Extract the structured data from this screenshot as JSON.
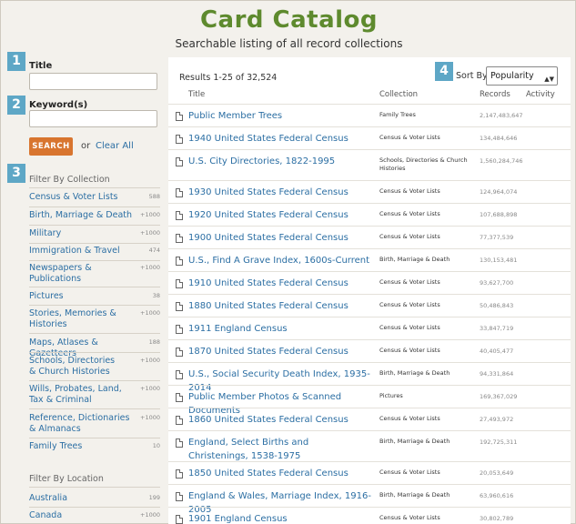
{
  "header": {
    "title": "Card Catalog",
    "subtitle": "Searchable listing of all record collections"
  },
  "search": {
    "badge_title": "1",
    "title_label": "Title",
    "title_value": "",
    "badge_keyword": "2",
    "keyword_label": "Keyword(s)",
    "keyword_value": "",
    "search_button": "SEARCH",
    "or_text": "or",
    "clear_link": "Clear All"
  },
  "filter_collection": {
    "badge": "3",
    "heading": "Filter By Collection",
    "items": [
      {
        "name": "Census & Voter Lists",
        "count": "588"
      },
      {
        "name": "Birth, Marriage & Death",
        "count": "+1000"
      },
      {
        "name": "Military",
        "count": "+1000"
      },
      {
        "name": "Immigration & Travel",
        "count": "474"
      },
      {
        "name": "Newspapers & Publications",
        "count": "+1000"
      },
      {
        "name": "Pictures",
        "count": "38"
      },
      {
        "name": "Stories, Memories & Histories",
        "count": "+1000"
      },
      {
        "name": "Maps, Atlases & Gazetteers",
        "count": "188"
      },
      {
        "name": "Schools, Directories & Church Histories",
        "count": "+1000"
      },
      {
        "name": "Wills, Probates, Land, Tax & Criminal",
        "count": "+1000"
      },
      {
        "name": "Reference, Dictionaries & Almanacs",
        "count": "+1000"
      },
      {
        "name": "Family Trees",
        "count": "10"
      }
    ]
  },
  "filter_location": {
    "heading": "Filter By Location",
    "items": [
      {
        "name": "Australia",
        "count": "199"
      },
      {
        "name": "Canada",
        "count": "+1000"
      }
    ]
  },
  "results": {
    "count_text": "Results 1-25 of 32,524",
    "sort_badge": "4",
    "sort_label": "Sort By",
    "sort_value": "Popularity",
    "columns": {
      "title": "Title",
      "collection": "Collection",
      "records": "Records",
      "activity": "Activity"
    },
    "rows": [
      {
        "title": "Public Member Trees",
        "collection": "Family Trees",
        "records": "2,147,483,647"
      },
      {
        "title": "1940 United States Federal Census",
        "collection": "Census & Voter Lists",
        "records": "134,484,646"
      },
      {
        "title": "U.S. City Directories, 1822-1995",
        "collection": "Schools, Directories & Church Histories",
        "records": "1,560,284,746"
      },
      {
        "title": "1930 United States Federal Census",
        "collection": "Census & Voter Lists",
        "records": "124,964,074"
      },
      {
        "title": "1920 United States Federal Census",
        "collection": "Census & Voter Lists",
        "records": "107,688,898"
      },
      {
        "title": "1900 United States Federal Census",
        "collection": "Census & Voter Lists",
        "records": "77,377,539"
      },
      {
        "title": "U.S., Find A Grave Index, 1600s-Current",
        "collection": "Birth, Marriage & Death",
        "records": "130,153,481"
      },
      {
        "title": "1910 United States Federal Census",
        "collection": "Census & Voter Lists",
        "records": "93,627,700"
      },
      {
        "title": "1880 United States Federal Census",
        "collection": "Census & Voter Lists",
        "records": "50,486,843"
      },
      {
        "title": "1911 England Census",
        "collection": "Census & Voter Lists",
        "records": "33,847,719"
      },
      {
        "title": "1870 United States Federal Census",
        "collection": "Census & Voter Lists",
        "records": "40,405,477"
      },
      {
        "title": "U.S., Social Security Death Index, 1935-2014",
        "collection": "Birth, Marriage & Death",
        "records": "94,331,864"
      },
      {
        "title": "Public Member Photos & Scanned Documents",
        "collection": "Pictures",
        "records": "169,367,029"
      },
      {
        "title": "1860 United States Federal Census",
        "collection": "Census & Voter Lists",
        "records": "27,493,972"
      },
      {
        "title": "England, Select Births and Christenings, 1538-1975",
        "collection": "Birth, Marriage & Death",
        "records": "192,725,311"
      },
      {
        "title": "1850 United States Federal Census",
        "collection": "Census & Voter Lists",
        "records": "20,053,649"
      },
      {
        "title": "England & Wales, Marriage Index, 1916-2005",
        "collection": "Birth, Marriage & Death",
        "records": "63,960,616"
      },
      {
        "title": "1901 England Census",
        "collection": "Census & Voter Lists",
        "records": "30,802,789"
      }
    ]
  },
  "colors": {
    "title_green": "#5e8a2e",
    "link_blue": "#2b6ea3",
    "badge_blue": "#5ea7c6",
    "search_orange": "#d8752f"
  }
}
